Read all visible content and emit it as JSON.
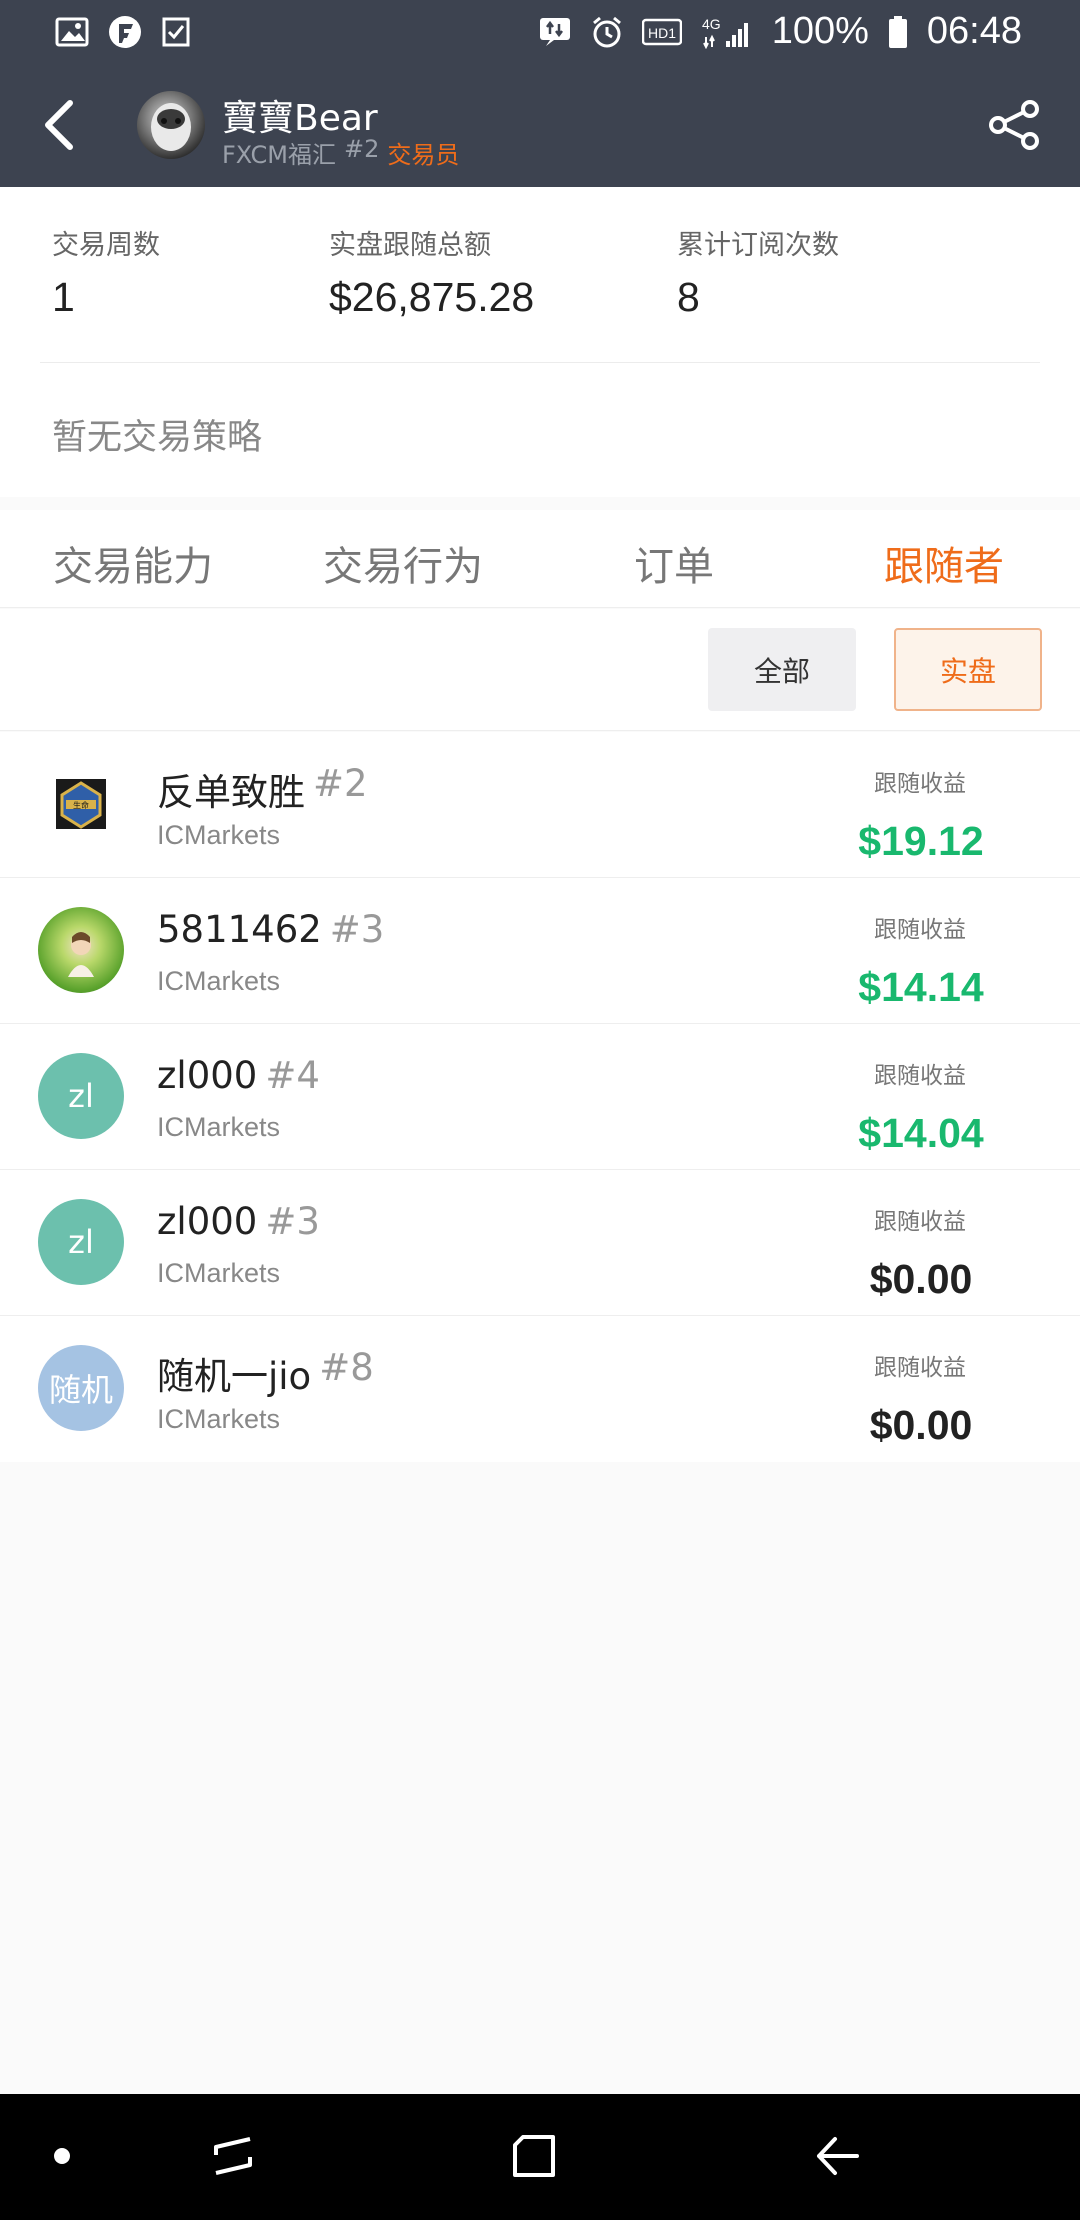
{
  "status_bar": {
    "battery": "100%",
    "time": "06:48",
    "network": "4G",
    "hd_badge": "HD1"
  },
  "header": {
    "name": "寶寶Bear",
    "broker": "FXCM福汇",
    "rank": "#2",
    "role": "交易员"
  },
  "stats": [
    {
      "label": "交易周数",
      "value": "1"
    },
    {
      "label": "实盘跟随总额",
      "value": "$26,875.28"
    },
    {
      "label": "累计订阅次数",
      "value": "8"
    }
  ],
  "strategy_text": "暂无交易策略",
  "tabs": [
    {
      "label": "交易能力",
      "active": false
    },
    {
      "label": "交易行为",
      "active": false
    },
    {
      "label": "订单",
      "active": false
    },
    {
      "label": "跟随者",
      "active": true
    }
  ],
  "filters": {
    "all": "全部",
    "real": "实盘"
  },
  "followers": [
    {
      "name": "反单致胜",
      "rank": "#2",
      "broker": "ICMarkets",
      "earn_label": "跟随收益",
      "earn": "$19.12",
      "avatar_text": "",
      "avatar_type": "badge"
    },
    {
      "name": "5811462",
      "rank": "#3",
      "broker": "ICMarkets",
      "earn_label": "跟随收益",
      "earn": "$14.14",
      "avatar_text": "",
      "avatar_type": "photo"
    },
    {
      "name": "zl000",
      "rank": "#4",
      "broker": "ICMarkets",
      "earn_label": "跟随收益",
      "earn": "$14.04",
      "avatar_text": "zl",
      "avatar_type": "teal"
    },
    {
      "name": "zl000",
      "rank": "#3",
      "broker": "ICMarkets",
      "earn_label": "跟随收益",
      "earn": "$0.00",
      "avatar_text": "zl",
      "avatar_type": "teal"
    },
    {
      "name": "随机一jio",
      "rank": "#8",
      "broker": "ICMarkets",
      "earn_label": "跟随收益",
      "earn": "$0.00",
      "avatar_text": "随机",
      "avatar_type": "blue"
    }
  ],
  "colors": {
    "header_bg": "#3d4350",
    "accent": "#ef6c1a",
    "positive": "#19b86e"
  }
}
